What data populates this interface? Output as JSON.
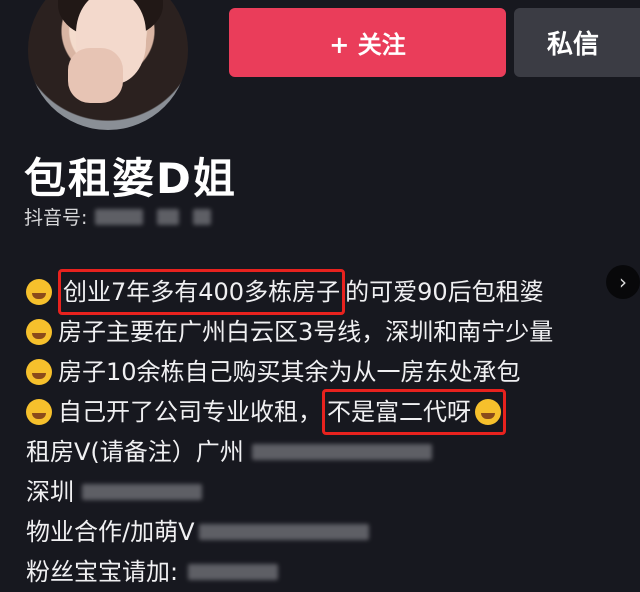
{
  "header": {
    "follow_label": "+ 关注",
    "message_label": "私信"
  },
  "profile": {
    "name": "包租婆D姐",
    "douyin_id_label": "抖音号:"
  },
  "bio": {
    "line1_highlight": "创业7年多有400多栋房子",
    "line1_rest": "的可爱90后包租婆",
    "line2": "房子主要在广州白云区3号线，深圳和南宁少量",
    "line3": "房子10余栋自己购买其余为从一房东处承包",
    "line4_start": "自己开了公司专业收租，",
    "line4_highlight": "不是富二代呀",
    "line5": "租房V(请备注）广州",
    "line6": "深圳",
    "line7": "物业合作/加萌V",
    "line8": "粉丝宝宝请加:"
  },
  "icons": {
    "next": "chevron-right-icon",
    "emoji": "emoji-icon"
  },
  "colors": {
    "follow_button": "#ea3d5a",
    "message_button": "#3b3c44",
    "highlight_box": "#e8221e"
  }
}
